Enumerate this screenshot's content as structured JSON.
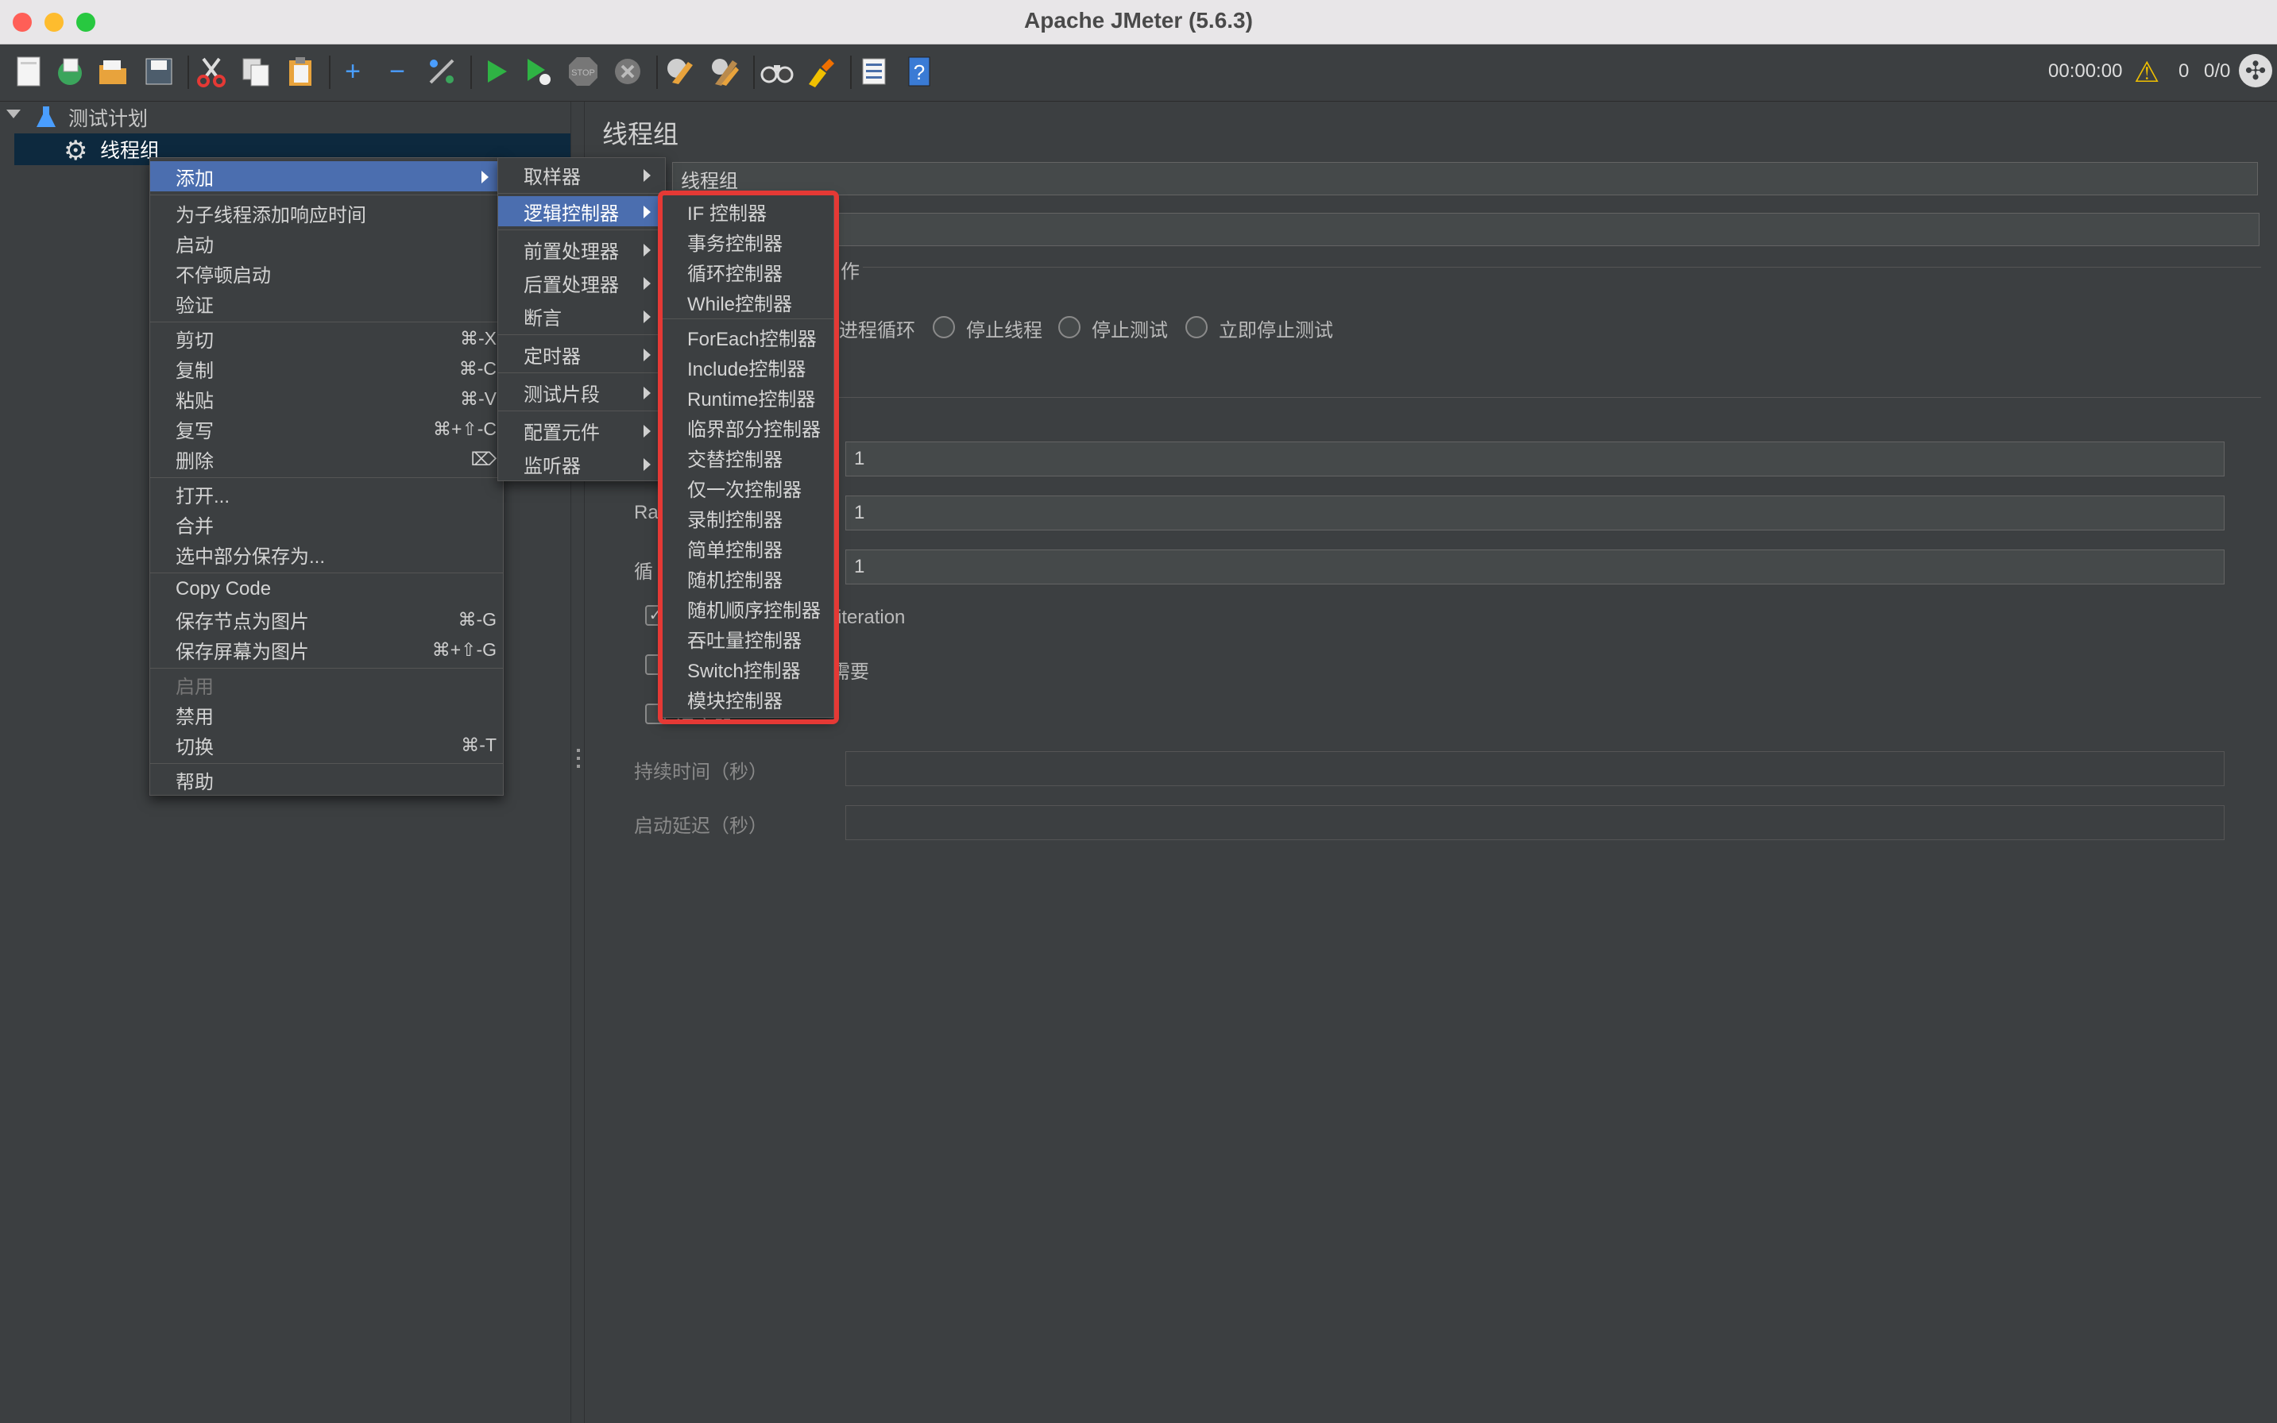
{
  "window": {
    "title": "Apache JMeter (5.6.3)"
  },
  "toolbar": {
    "icons": [
      "new-icon",
      "templates-icon",
      "open-icon",
      "save-icon",
      "cut-icon",
      "copy-icon",
      "paste-icon",
      "expand-icon",
      "collapse-icon",
      "toggle-icon",
      "start-icon",
      "start-no-pause-icon",
      "stop-icon",
      "shutdown-icon",
      "clear-icon",
      "clear-all-icon",
      "search-icon",
      "reset-search-icon",
      "function-helper-icon",
      "help-icon"
    ],
    "timer": "00:00:00",
    "warnings": "0",
    "threads": "0/0"
  },
  "tree": {
    "root": "测试计划",
    "child": "线程组"
  },
  "panel": {
    "title": "线程组",
    "name_value": "线程组",
    "action_section_suffix": "作",
    "radio_options": [
      "进程循环",
      "停止线程",
      "停止测试",
      "立即停止测试"
    ],
    "label_ramp": "Ra",
    "label_loop": "循",
    "threads_value": "1",
    "ramp_value": "1",
    "loop_value": "1",
    "same_user_suffix": "iteration",
    "delay_suffix": "需要",
    "scheduler_partial": "调度器",
    "duration_label": "持续时间（秒）",
    "startup_delay_label": "启动延迟（秒）"
  },
  "context_menu": {
    "items": [
      {
        "label": "添加",
        "shortcut": "",
        "submenu": true
      },
      {
        "label": "为子线程添加响应时间",
        "shortcut": ""
      },
      {
        "label": "启动",
        "shortcut": ""
      },
      {
        "label": "不停顿启动",
        "shortcut": ""
      },
      {
        "label": "验证",
        "shortcut": ""
      },
      {
        "label": "剪切",
        "shortcut": "⌘-X"
      },
      {
        "label": "复制",
        "shortcut": "⌘-C"
      },
      {
        "label": "粘贴",
        "shortcut": "⌘-V"
      },
      {
        "label": "复写",
        "shortcut": "⌘+⇧-C"
      },
      {
        "label": "删除",
        "shortcut": "⌦"
      },
      {
        "label": "打开...",
        "shortcut": ""
      },
      {
        "label": "合并",
        "shortcut": ""
      },
      {
        "label": "选中部分保存为...",
        "shortcut": ""
      },
      {
        "label": "Copy Code",
        "shortcut": ""
      },
      {
        "label": "保存节点为图片",
        "shortcut": "⌘-G"
      },
      {
        "label": "保存屏幕为图片",
        "shortcut": "⌘+⇧-G"
      },
      {
        "label": "启用",
        "shortcut": ""
      },
      {
        "label": "禁用",
        "shortcut": ""
      },
      {
        "label": "切换",
        "shortcut": "⌘-T"
      },
      {
        "label": "帮助",
        "shortcut": ""
      }
    ]
  },
  "add_submenu": {
    "items": [
      "取样器",
      "逻辑控制器",
      "前置处理器",
      "后置处理器",
      "断言",
      "定时器",
      "测试片段",
      "配置元件",
      "监听器"
    ]
  },
  "logic_submenu": {
    "items": [
      "IF 控制器",
      "事务控制器",
      "循环控制器",
      "While控制器",
      "ForEach控制器",
      "Include控制器",
      "Runtime控制器",
      "临界部分控制器",
      "交替控制器",
      "仅一次控制器",
      "录制控制器",
      "简单控制器",
      "随机控制器",
      "随机顺序控制器",
      "吞吐量控制器",
      "Switch控制器",
      "模块控制器"
    ]
  },
  "colors": {
    "background": "#3c3f41",
    "menu_active": "#4b6eaf",
    "highlight": "#e53935",
    "tree_selected": "#0d293e"
  }
}
